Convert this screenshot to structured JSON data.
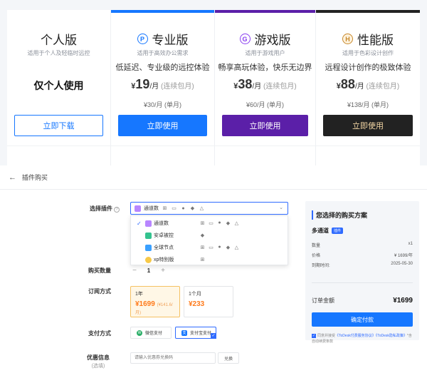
{
  "plans": [
    {
      "name": "个人版",
      "subtitle": "适用于个人及轻临时远控",
      "highlight": "仅个人使用",
      "button": "立即下载",
      "color": "#1677ff",
      "badge": ""
    },
    {
      "name": "专业版",
      "subtitle": "适用于高效办公需求",
      "desc": "低延迟、专业级的远控体验",
      "price": "19",
      "unit": "/月",
      "note": "(连续包月)",
      "sub_price": "¥30/月 (单月)",
      "button": "立即使用",
      "color": "#1677ff",
      "badge": "P"
    },
    {
      "name": "游戏版",
      "subtitle": "适用于游戏用户",
      "desc": "畅享高玩体验，快乐无边界",
      "price": "38",
      "unit": "/月",
      "note": "(连续包月)",
      "sub_price": "¥60/月 (单月)",
      "button": "立即使用",
      "color": "#5b1fa8",
      "badge": "G"
    },
    {
      "name": "性能版",
      "subtitle": "适用于色彩设计创作",
      "desc": "远程设计创作的极致体验",
      "price": "88",
      "unit": "/月",
      "note": "(连续包月)",
      "sub_price": "¥138/月 (单月)",
      "button": "立即使用",
      "color": "#222222",
      "badge": "H"
    }
  ],
  "back": {
    "label": "插件购买"
  },
  "form": {
    "plugin_label": "选择插件",
    "selected_plugin": "通道数",
    "dropdown": [
      {
        "name": "通道数",
        "checked": true,
        "color": "#b886ff"
      },
      {
        "name": "安卓被控",
        "checked": false,
        "color": "#34c38f"
      },
      {
        "name": "全球节点",
        "checked": false,
        "color": "#3aa0ff"
      },
      {
        "name": "xp特别版",
        "checked": false,
        "color": "#f7c948"
      }
    ],
    "qty_label": "购买数量",
    "qty": "1",
    "qty_minus": "−",
    "qty_plus": "+",
    "sub_label": "订阅方式",
    "sub_options": [
      {
        "title": "1年",
        "price": "¥1699",
        "per": "(¥141.6/月)"
      },
      {
        "title": "1个月",
        "price": "¥233",
        "per": ""
      }
    ],
    "pay_label": "支付方式",
    "pay_options": [
      {
        "name": "微信支付",
        "color": "#2aae67",
        "glyph": "W"
      },
      {
        "name": "支付宝支付",
        "color": "#1677ff",
        "glyph": "支"
      }
    ],
    "coupon_label": "优惠信息",
    "coupon_sub": "(选填)",
    "coupon_placeholder": "请输入优惠券兑换码",
    "coupon_button": "兑换"
  },
  "summary": {
    "title": "您选择的购买方案",
    "plan": "多通道",
    "tag": "插件",
    "rows": [
      {
        "k": "数量",
        "v": "x1"
      },
      {
        "k": "价格",
        "v": "¥ 1699/年"
      },
      {
        "k": "到期时间:",
        "v": "2025-05-30"
      }
    ],
    "total_label": "订单金额",
    "total": "¥1699",
    "confirm": "确定付款",
    "agree_pre": "同意并接受",
    "agree_link1": "《ToDesk付费服务协议》",
    "agree_link2": "《ToDesk隐私政策》",
    "agree_post": "*含自动续费条款"
  }
}
